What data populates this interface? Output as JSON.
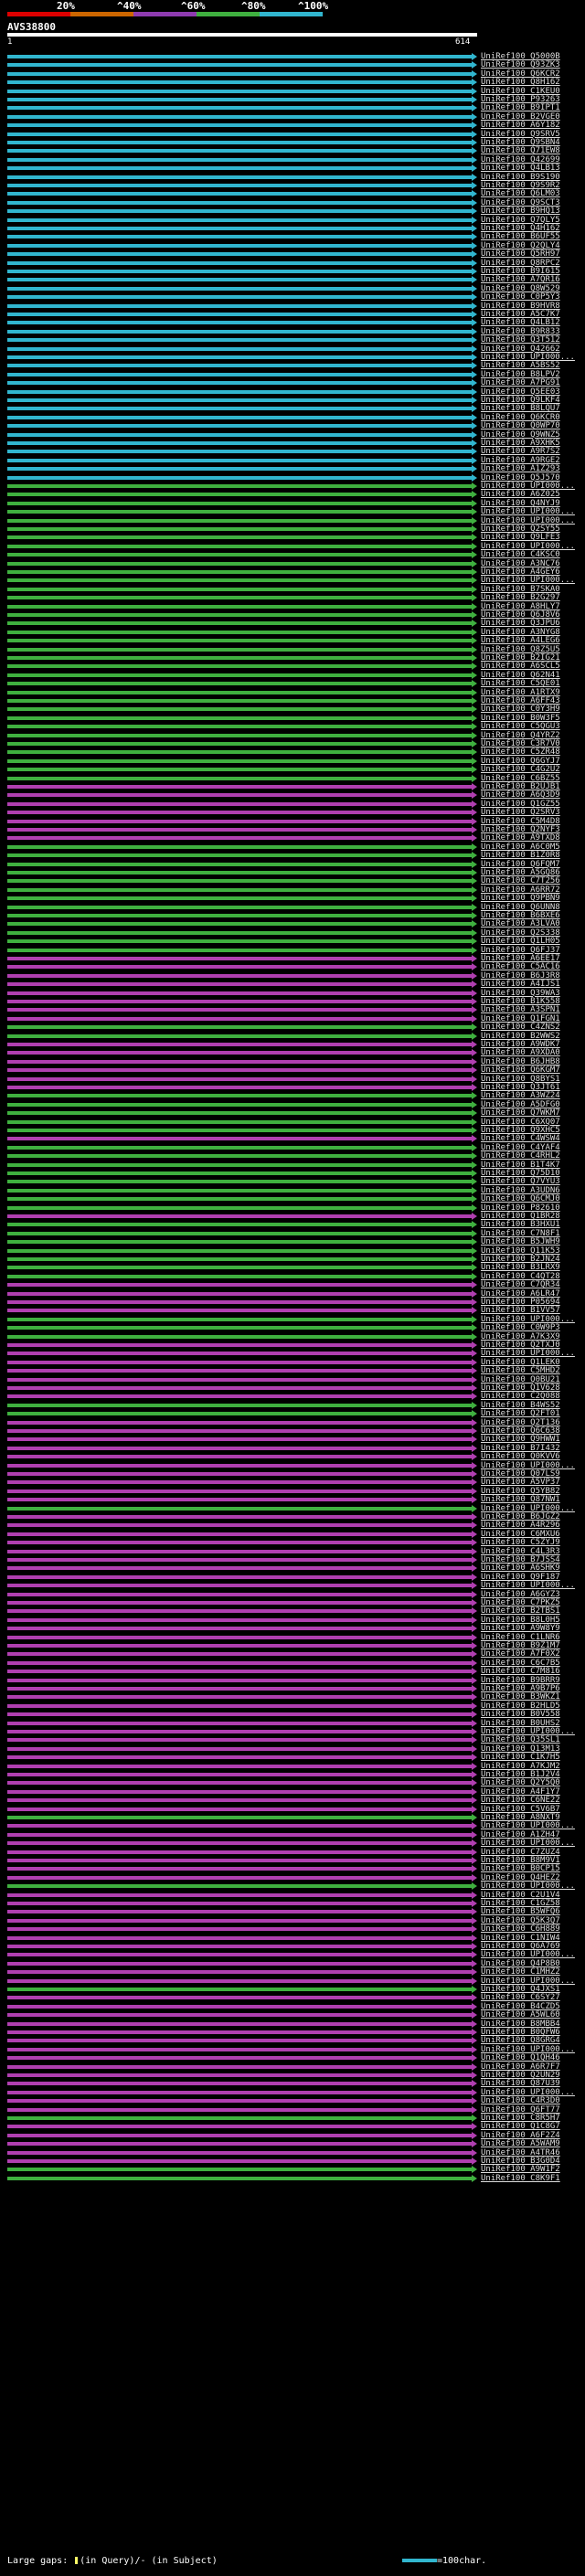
{
  "legend": {
    "labels": [
      "20%",
      "^40%",
      "^60%",
      "^80%",
      "^100%"
    ],
    "colors": [
      "#dd0000",
      "#cc6600",
      "#8e3bb0",
      "#4caf50",
      "#31b6cf"
    ]
  },
  "query": {
    "id": "AVS38800",
    "start": "1",
    "end": "614"
  },
  "color_map": {
    "cyan": "#31b6cf",
    "green": "#3fb03f",
    "magenta": "#b03fb0"
  },
  "hits": [
    {
      "label": "UniRef100_Q5000B",
      "color": "cyan"
    },
    {
      "label": "UniRef100_Q93ZK3",
      "color": "cyan"
    },
    {
      "label": "UniRef100_Q6KCR2",
      "color": "cyan"
    },
    {
      "label": "UniRef100_Q8H162",
      "color": "cyan"
    },
    {
      "label": "UniRef100_C1KEU0",
      "color": "cyan"
    },
    {
      "label": "UniRef100_P93263",
      "color": "cyan"
    },
    {
      "label": "UniRef100_B9IPT1",
      "color": "cyan"
    },
    {
      "label": "UniRef100_B2VGE0",
      "color": "cyan"
    },
    {
      "label": "UniRef100_A6Y182",
      "color": "cyan"
    },
    {
      "label": "UniRef100_Q9SRV5",
      "color": "cyan"
    },
    {
      "label": "UniRef100_Q9SBN4",
      "color": "cyan"
    },
    {
      "label": "UniRef100_Q71EW8",
      "color": "cyan"
    },
    {
      "label": "UniRef100_Q42699",
      "color": "cyan"
    },
    {
      "label": "UniRef100_Q4LB13",
      "color": "cyan"
    },
    {
      "label": "UniRef100_B9S190",
      "color": "cyan"
    },
    {
      "label": "UniRef100_Q9S9R2",
      "color": "cyan"
    },
    {
      "label": "UniRef100_Q6LM03",
      "color": "cyan"
    },
    {
      "label": "UniRef100_Q9SCT3",
      "color": "cyan"
    },
    {
      "label": "UniRef100_B9HQ13",
      "color": "cyan"
    },
    {
      "label": "UniRef100_Q7QLY5",
      "color": "cyan"
    },
    {
      "label": "UniRef100_Q4H162",
      "color": "cyan"
    },
    {
      "label": "UniRef100_B6UF55",
      "color": "cyan"
    },
    {
      "label": "UniRef100_Q2QLY4",
      "color": "cyan"
    },
    {
      "label": "UniRef100_Q5RH97",
      "color": "cyan"
    },
    {
      "label": "UniRef100_Q8RPC2",
      "color": "cyan"
    },
    {
      "label": "UniRef100_B9I615",
      "color": "cyan"
    },
    {
      "label": "UniRef100_A7QR16",
      "color": "cyan"
    },
    {
      "label": "UniRef100_Q8W529",
      "color": "cyan"
    },
    {
      "label": "UniRef100_C0P5Y3",
      "color": "cyan"
    },
    {
      "label": "UniRef100_B9HVR8",
      "color": "cyan"
    },
    {
      "label": "UniRef100_A5C7K7",
      "color": "cyan"
    },
    {
      "label": "UniRef100_Q4LB12",
      "color": "cyan"
    },
    {
      "label": "UniRef100_B9R833",
      "color": "cyan"
    },
    {
      "label": "UniRef100_Q3T512",
      "color": "cyan"
    },
    {
      "label": "UniRef100_Q42662",
      "color": "cyan"
    },
    {
      "label": "UniRef100_UPI000...",
      "color": "cyan"
    },
    {
      "label": "UniRef100_A5BS52",
      "color": "cyan"
    },
    {
      "label": "UniRef100_B8LPV2",
      "color": "cyan"
    },
    {
      "label": "UniRef100_A7PG91",
      "color": "cyan"
    },
    {
      "label": "UniRef100_Q5EE03",
      "color": "cyan"
    },
    {
      "label": "UniRef100_Q9LKF4",
      "color": "cyan"
    },
    {
      "label": "UniRef100_B8LQU7",
      "color": "cyan"
    },
    {
      "label": "UniRef100_Q6KCR0",
      "color": "cyan"
    },
    {
      "label": "UniRef100_Q0WP70",
      "color": "cyan"
    },
    {
      "label": "UniRef100_Q9WNZ5",
      "color": "cyan"
    },
    {
      "label": "UniRef100_A9XHK5",
      "color": "cyan"
    },
    {
      "label": "UniRef100_A9R7S2",
      "color": "cyan"
    },
    {
      "label": "UniRef100_A9RGE2",
      "color": "cyan"
    },
    {
      "label": "UniRef100_A1Z293",
      "color": "cyan"
    },
    {
      "label": "UniRef100_Q5J570",
      "color": "cyan"
    },
    {
      "label": "UniRef100_UPI000...",
      "color": "green"
    },
    {
      "label": "UniRef100_A6Z025",
      "color": "green"
    },
    {
      "label": "UniRef100_Q4NYJ9",
      "color": "green"
    },
    {
      "label": "UniRef100_UPI000...",
      "color": "green"
    },
    {
      "label": "UniRef100_UPI000...",
      "color": "green"
    },
    {
      "label": "UniRef100_Q2SY55",
      "color": "green"
    },
    {
      "label": "UniRef100_Q9LFE3",
      "color": "green"
    },
    {
      "label": "UniRef100_UPI000...",
      "color": "green"
    },
    {
      "label": "UniRef100_C4KSC0",
      "color": "green"
    },
    {
      "label": "UniRef100_A3NC76",
      "color": "green"
    },
    {
      "label": "UniRef100_A4GEY6",
      "color": "green"
    },
    {
      "label": "UniRef100_UPI000...",
      "color": "green"
    },
    {
      "label": "UniRef100_B7SKA0",
      "color": "green"
    },
    {
      "label": "UniRef100_B2G297",
      "color": "green"
    },
    {
      "label": "UniRef100_A8HLY7",
      "color": "green"
    },
    {
      "label": "UniRef100_Q6J8V6",
      "color": "green"
    },
    {
      "label": "UniRef100_Q3JPU6",
      "color": "green"
    },
    {
      "label": "UniRef100_A3NYG8",
      "color": "green"
    },
    {
      "label": "UniRef100_A4LEG6",
      "color": "green"
    },
    {
      "label": "UniRef100_Q8Z5U5",
      "color": "green"
    },
    {
      "label": "UniRef100_B2IG21",
      "color": "green"
    },
    {
      "label": "UniRef100_A6SCL5",
      "color": "green"
    },
    {
      "label": "UniRef100_Q62N41",
      "color": "green"
    },
    {
      "label": "UniRef100_C5QE01",
      "color": "green"
    },
    {
      "label": "UniRef100_A1RTX9",
      "color": "green"
    },
    {
      "label": "UniRef100_A6FF43",
      "color": "green"
    },
    {
      "label": "UniRef100_C0Y3H9",
      "color": "green"
    },
    {
      "label": "UniRef100_B0W3F5",
      "color": "green"
    },
    {
      "label": "UniRef100_C5QGU3",
      "color": "green"
    },
    {
      "label": "UniRef100_Q4YRZ2",
      "color": "green"
    },
    {
      "label": "UniRef100_C3R7V0",
      "color": "green"
    },
    {
      "label": "UniRef100_C5ZR48",
      "color": "green"
    },
    {
      "label": "UniRef100_Q6GYJ7",
      "color": "green"
    },
    {
      "label": "UniRef100_C4G2U2",
      "color": "green"
    },
    {
      "label": "UniRef100_C6BZ55",
      "color": "green"
    },
    {
      "label": "UniRef100_B2UJB1",
      "color": "magenta"
    },
    {
      "label": "UniRef100_A6Q3D9",
      "color": "magenta"
    },
    {
      "label": "UniRef100_Q1GZ55",
      "color": "magenta"
    },
    {
      "label": "UniRef100_Q2SRV3",
      "color": "magenta"
    },
    {
      "label": "UniRef100_C5M4D8",
      "color": "magenta"
    },
    {
      "label": "UniRef100_Q2NYF3",
      "color": "magenta"
    },
    {
      "label": "UniRef100_A9TXD8",
      "color": "magenta"
    },
    {
      "label": "UniRef100_A6C0M5",
      "color": "green"
    },
    {
      "label": "UniRef100_B1Z0R8",
      "color": "green"
    },
    {
      "label": "UniRef100_Q6FQM7",
      "color": "green"
    },
    {
      "label": "UniRef100_A5GQ86",
      "color": "green"
    },
    {
      "label": "UniRef100_C7T256",
      "color": "green"
    },
    {
      "label": "UniRef100_A6RR72",
      "color": "green"
    },
    {
      "label": "UniRef100_Q9PBN9",
      "color": "green"
    },
    {
      "label": "UniRef100_Q6UNN8",
      "color": "green"
    },
    {
      "label": "UniRef100_B6BXE6",
      "color": "green"
    },
    {
      "label": "UniRef100_A3LVA0",
      "color": "green"
    },
    {
      "label": "UniRef100_Q2S338",
      "color": "green"
    },
    {
      "label": "UniRef100_Q1LH05",
      "color": "green"
    },
    {
      "label": "UniRef100_Q6FJ37",
      "color": "green"
    },
    {
      "label": "UniRef100_A6EE17",
      "color": "magenta"
    },
    {
      "label": "UniRef100_C5AC16",
      "color": "magenta"
    },
    {
      "label": "UniRef100_B6J3R8",
      "color": "magenta"
    },
    {
      "label": "UniRef100_A4IJS1",
      "color": "magenta"
    },
    {
      "label": "UniRef100_Q39WA3",
      "color": "magenta"
    },
    {
      "label": "UniRef100_B1K558",
      "color": "magenta"
    },
    {
      "label": "UniRef100_A3SPN1",
      "color": "magenta"
    },
    {
      "label": "UniRef100_Q1FGN1",
      "color": "magenta"
    },
    {
      "label": "UniRef100_C4ZNS2",
      "color": "green"
    },
    {
      "label": "UniRef100_B2WWS2",
      "color": "green"
    },
    {
      "label": "UniRef100_A9WDK7",
      "color": "magenta"
    },
    {
      "label": "UniRef100_A9XDA0",
      "color": "magenta"
    },
    {
      "label": "UniRef100_B6JHB8",
      "color": "magenta"
    },
    {
      "label": "UniRef100_Q6KGM7",
      "color": "magenta"
    },
    {
      "label": "UniRef100_Q8BYS1",
      "color": "magenta"
    },
    {
      "label": "UniRef100_Q3JT61",
      "color": "magenta"
    },
    {
      "label": "UniRef100_A3WZ24",
      "color": "green"
    },
    {
      "label": "UniRef100_A5DFG0",
      "color": "green"
    },
    {
      "label": "UniRef100_Q7WKM7",
      "color": "green"
    },
    {
      "label": "UniRef100_C6XQ07",
      "color": "green"
    },
    {
      "label": "UniRef100_Q9XHC5",
      "color": "green"
    },
    {
      "label": "UniRef100_C4WSW4",
      "color": "magenta"
    },
    {
      "label": "UniRef100_C4YAF4",
      "color": "green"
    },
    {
      "label": "UniRef100_C4RHL2",
      "color": "green"
    },
    {
      "label": "UniRef100_B1T4K7",
      "color": "green"
    },
    {
      "label": "UniRef100_Q75D10",
      "color": "green"
    },
    {
      "label": "UniRef100_Q7VYU3",
      "color": "green"
    },
    {
      "label": "UniRef100_A3UDN6",
      "color": "green"
    },
    {
      "label": "UniRef100_Q6CMJ0",
      "color": "green"
    },
    {
      "label": "UniRef100_P82610",
      "color": "green"
    },
    {
      "label": "UniRef100_Q1BR28",
      "color": "magenta"
    },
    {
      "label": "UniRef100_B3HXU1",
      "color": "green"
    },
    {
      "label": "UniRef100_C7N8F1",
      "color": "green"
    },
    {
      "label": "UniRef100_B5JWH9",
      "color": "green"
    },
    {
      "label": "UniRef100_Q11K53",
      "color": "green"
    },
    {
      "label": "UniRef100_B2JN24",
      "color": "green"
    },
    {
      "label": "UniRef100_B3LRX9",
      "color": "green"
    },
    {
      "label": "UniRef100_C4QT28",
      "color": "green"
    },
    {
      "label": "UniRef100_C7QR34",
      "color": "magenta"
    },
    {
      "label": "UniRef100_A6LR47",
      "color": "magenta"
    },
    {
      "label": "UniRef100_P05694",
      "color": "magenta"
    },
    {
      "label": "UniRef100_B1VV57",
      "color": "magenta"
    },
    {
      "label": "UniRef100_UPI000...",
      "color": "green"
    },
    {
      "label": "UniRef100_C0W9P3",
      "color": "green"
    },
    {
      "label": "UniRef100_A7K3X9",
      "color": "green"
    },
    {
      "label": "UniRef100_Q2TXJ0",
      "color": "magenta"
    },
    {
      "label": "UniRef100_UPI000...",
      "color": "magenta"
    },
    {
      "label": "UniRef100_Q1LEK0",
      "color": "magenta"
    },
    {
      "label": "UniRef100_C5MHD2",
      "color": "magenta"
    },
    {
      "label": "UniRef100_Q0BU21",
      "color": "magenta"
    },
    {
      "label": "UniRef100_Q1V628",
      "color": "magenta"
    },
    {
      "label": "UniRef100_C2Q088",
      "color": "magenta"
    },
    {
      "label": "UniRef100_B4WS52",
      "color": "green"
    },
    {
      "label": "UniRef100_Q2FT01",
      "color": "green"
    },
    {
      "label": "UniRef100_Q2T136",
      "color": "magenta"
    },
    {
      "label": "UniRef100_Q6C638",
      "color": "magenta"
    },
    {
      "label": "UniRef100_Q9HWW1",
      "color": "magenta"
    },
    {
      "label": "UniRef100_B7I432",
      "color": "magenta"
    },
    {
      "label": "UniRef100_Q0KVV6",
      "color": "magenta"
    },
    {
      "label": "UniRef100_UPI000...",
      "color": "magenta"
    },
    {
      "label": "UniRef100_Q07LS9",
      "color": "magenta"
    },
    {
      "label": "UniRef100_A5VP37",
      "color": "magenta"
    },
    {
      "label": "UniRef100_Q5YB82",
      "color": "magenta"
    },
    {
      "label": "UniRef100_Q87NW1",
      "color": "magenta"
    },
    {
      "label": "UniRef100_UPI000...",
      "color": "green"
    },
    {
      "label": "UniRef100_B6JGZ2",
      "color": "magenta"
    },
    {
      "label": "UniRef100_A4R296",
      "color": "magenta"
    },
    {
      "label": "UniRef100_C6MXU6",
      "color": "magenta"
    },
    {
      "label": "UniRef100_C5ZYJ9",
      "color": "magenta"
    },
    {
      "label": "UniRef100_C4L3R3",
      "color": "magenta"
    },
    {
      "label": "UniRef100_B7JSS4",
      "color": "magenta"
    },
    {
      "label": "UniRef100_A6SHK9",
      "color": "magenta"
    },
    {
      "label": "UniRef100_Q9F187",
      "color": "magenta"
    },
    {
      "label": "UniRef100_UPI000...",
      "color": "magenta"
    },
    {
      "label": "UniRef100_A6GYZ3",
      "color": "magenta"
    },
    {
      "label": "UniRef100_C7PKZ5",
      "color": "magenta"
    },
    {
      "label": "UniRef100_B2TBS1",
      "color": "magenta"
    },
    {
      "label": "UniRef100_B8L0H5",
      "color": "magenta"
    },
    {
      "label": "UniRef100_A9W8Y9",
      "color": "magenta"
    },
    {
      "label": "UniRef100_C1LNR6",
      "color": "magenta"
    },
    {
      "label": "UniRef100_B9Z1M7",
      "color": "magenta"
    },
    {
      "label": "UniRef100_A7F0X2",
      "color": "magenta"
    },
    {
      "label": "UniRef100_C6C7B5",
      "color": "magenta"
    },
    {
      "label": "UniRef100_C7M816",
      "color": "magenta"
    },
    {
      "label": "UniRef100_B9BRR9",
      "color": "magenta"
    },
    {
      "label": "UniRef100_A9B7P6",
      "color": "magenta"
    },
    {
      "label": "UniRef100_B3WKZ1",
      "color": "magenta"
    },
    {
      "label": "UniRef100_B2HLD5",
      "color": "magenta"
    },
    {
      "label": "UniRef100_B0V558",
      "color": "magenta"
    },
    {
      "label": "UniRef100_B0UHS2",
      "color": "magenta"
    },
    {
      "label": "UniRef100_UPI000...",
      "color": "magenta"
    },
    {
      "label": "UniRef100_Q35SL1",
      "color": "magenta"
    },
    {
      "label": "UniRef100_Q13M13",
      "color": "magenta"
    },
    {
      "label": "UniRef100_C1K7H5",
      "color": "magenta"
    },
    {
      "label": "UniRef100_A7KJM2",
      "color": "magenta"
    },
    {
      "label": "UniRef100_B1J2V4",
      "color": "magenta"
    },
    {
      "label": "UniRef100_Q2Y5Q0",
      "color": "magenta"
    },
    {
      "label": "UniRef100_A4F1Y7",
      "color": "magenta"
    },
    {
      "label": "UniRef100_C6NE22",
      "color": "magenta"
    },
    {
      "label": "UniRef100_C5V6B7",
      "color": "magenta"
    },
    {
      "label": "UniRef100_A8NXT9",
      "color": "green"
    },
    {
      "label": "UniRef100_UPI000...",
      "color": "magenta"
    },
    {
      "label": "UniRef100_A1ZH47",
      "color": "magenta"
    },
    {
      "label": "UniRef100_UPI000...",
      "color": "magenta"
    },
    {
      "label": "UniRef100_C7ZUZ4",
      "color": "magenta"
    },
    {
      "label": "UniRef100_B8M9V1",
      "color": "magenta"
    },
    {
      "label": "UniRef100_B0CP15",
      "color": "magenta"
    },
    {
      "label": "UniRef100_Q4HEZ2",
      "color": "magenta"
    },
    {
      "label": "UniRef100_UPI000...",
      "color": "green"
    },
    {
      "label": "UniRef100_C2U1V4",
      "color": "magenta"
    },
    {
      "label": "UniRef100_C1GZ58",
      "color": "magenta"
    },
    {
      "label": "UniRef100_B5WFQ6",
      "color": "magenta"
    },
    {
      "label": "UniRef100_Q5K3Q7",
      "color": "magenta"
    },
    {
      "label": "UniRef100_C6H889",
      "color": "magenta"
    },
    {
      "label": "UniRef100_C1NIW4",
      "color": "magenta"
    },
    {
      "label": "UniRef100_Q6A769",
      "color": "magenta"
    },
    {
      "label": "UniRef100_UPI000...",
      "color": "magenta"
    },
    {
      "label": "UniRef100_Q4P8B0",
      "color": "magenta"
    },
    {
      "label": "UniRef100_C1MHZ2",
      "color": "magenta"
    },
    {
      "label": "UniRef100_UPI000...",
      "color": "magenta"
    },
    {
      "label": "UniRef100_Q4JXS1",
      "color": "green"
    },
    {
      "label": "UniRef100_C6SY27",
      "color": "magenta"
    },
    {
      "label": "UniRef100_B4CZD5",
      "color": "magenta"
    },
    {
      "label": "UniRef100_A5WL60",
      "color": "magenta"
    },
    {
      "label": "UniRef100_B8MBB4",
      "color": "magenta"
    },
    {
      "label": "UniRef100_B0QFW6",
      "color": "magenta"
    },
    {
      "label": "UniRef100_Q8GRG4",
      "color": "magenta"
    },
    {
      "label": "UniRef100_UPI000...",
      "color": "magenta"
    },
    {
      "label": "UniRef100_Q1QH46",
      "color": "magenta"
    },
    {
      "label": "UniRef100_A6R7F7",
      "color": "magenta"
    },
    {
      "label": "UniRef100_Q2UN29",
      "color": "magenta"
    },
    {
      "label": "UniRef100_Q87U39",
      "color": "magenta"
    },
    {
      "label": "UniRef100_UPI000...",
      "color": "magenta"
    },
    {
      "label": "UniRef100_C4R3D0",
      "color": "magenta"
    },
    {
      "label": "UniRef100_Q6FT77",
      "color": "magenta"
    },
    {
      "label": "UniRef100_C8R5H7",
      "color": "green"
    },
    {
      "label": "UniRef100_Q1C8G7",
      "color": "magenta"
    },
    {
      "label": "UniRef100_A6F2Z4",
      "color": "magenta"
    },
    {
      "label": "UniRef100_A5WAM9",
      "color": "magenta"
    },
    {
      "label": "UniRef100_A4TR46",
      "color": "magenta"
    },
    {
      "label": "UniRef100_B3G0D4",
      "color": "magenta"
    },
    {
      "label": "UniRef100_A9W1F2",
      "color": "green"
    },
    {
      "label": "UniRef100_C8K9F1",
      "color": "green"
    }
  ],
  "footer": {
    "left_text": "Large gaps: ",
    "left_text_2": "(in Query)/- (in Subject)",
    "right_text": "=100char."
  }
}
